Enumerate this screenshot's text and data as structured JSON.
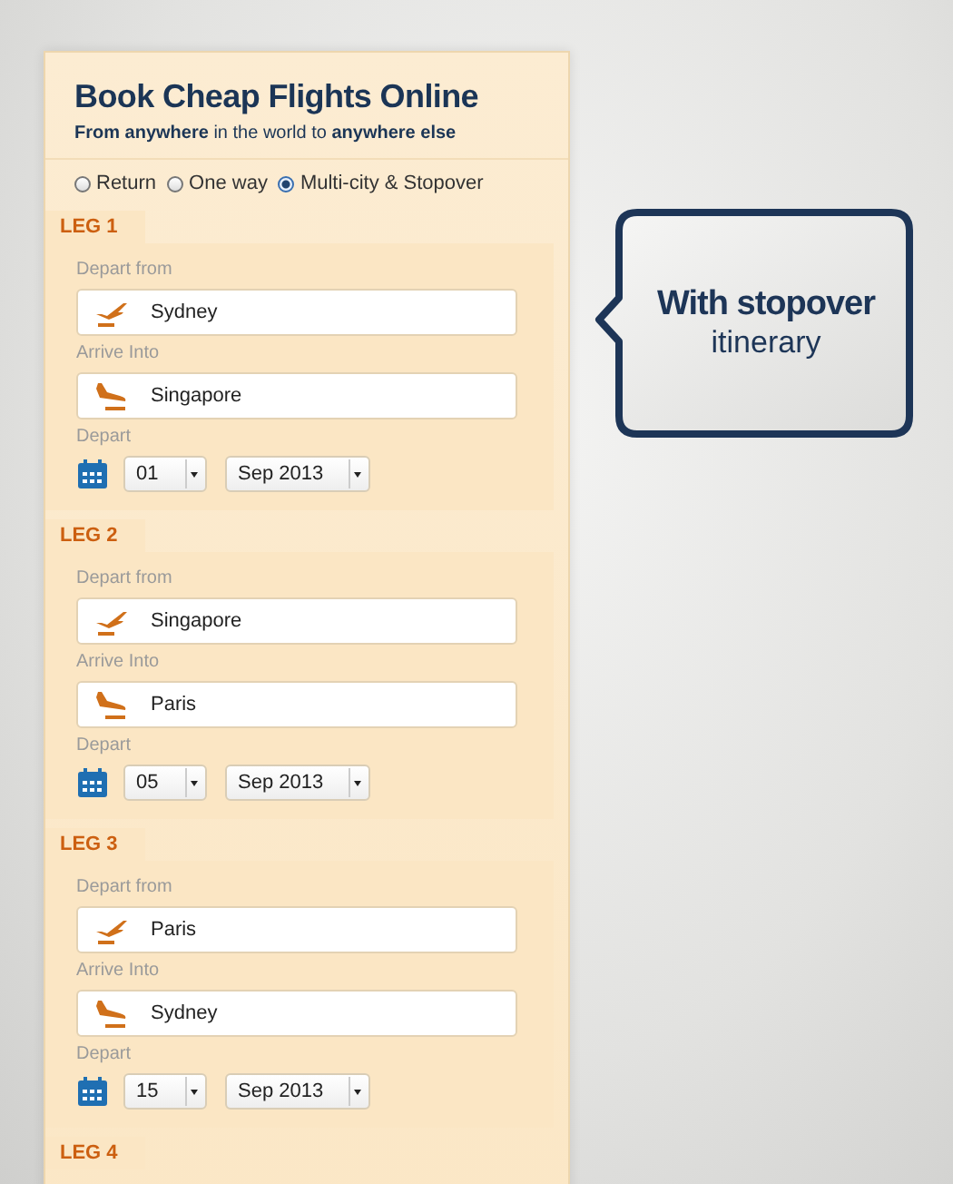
{
  "header": {
    "title": "Book Cheap Flights Online",
    "subtitle": "**From anywhere** in the world to **anywhere else**"
  },
  "trip_types": [
    {
      "label": "Return",
      "selected": false
    },
    {
      "label": "One way",
      "selected": false
    },
    {
      "label": "Multi-city & Stopover",
      "selected": true
    }
  ],
  "legs": [
    {
      "label": "LEG 1",
      "from_label": "Depart from",
      "from": "Sydney",
      "to_label": "Arrive Into",
      "to": "Singapore",
      "date_label": "Depart",
      "day": "01",
      "month": "Sep 2013"
    },
    {
      "label": "LEG 2",
      "from_label": "Depart from",
      "from": "Singapore",
      "to_label": "Arrive Into",
      "to": "Paris",
      "date_label": "Depart",
      "day": "05",
      "month": "Sep 2013"
    },
    {
      "label": "LEG 3",
      "from_label": "Depart from",
      "from": "Paris",
      "to_label": "Arrive Into",
      "to": "Sydney",
      "date_label": "Depart",
      "day": "15",
      "month": "Sep 2013"
    },
    {
      "label": "LEG 4"
    }
  ],
  "callout": {
    "title": "With stopover",
    "subtitle": "itinerary"
  }
}
